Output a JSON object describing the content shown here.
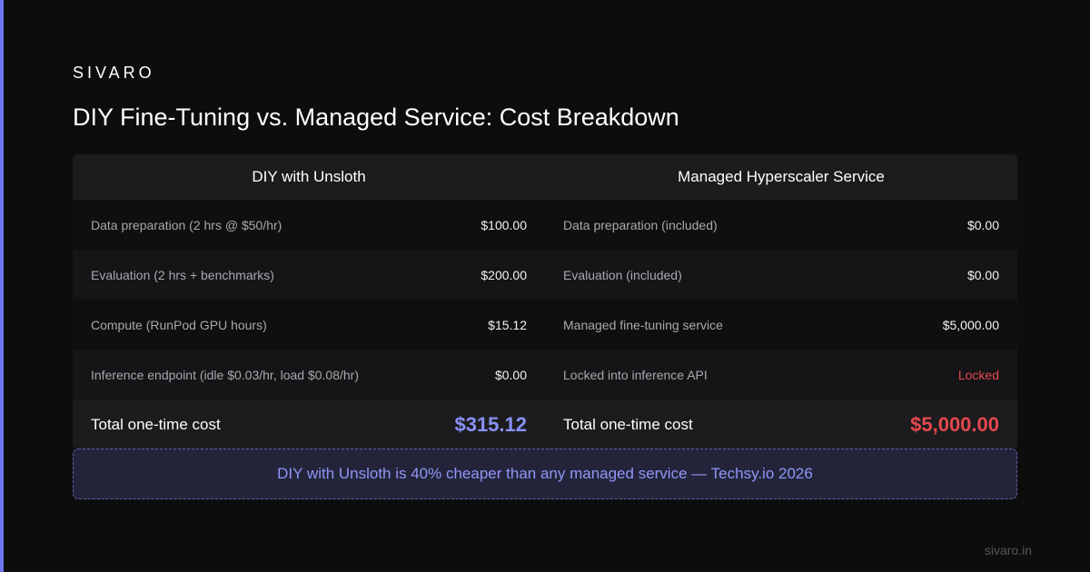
{
  "brand": "SIVARO",
  "title": "DIY Fine-Tuning vs. Managed Service: Cost Breakdown",
  "columns": {
    "diy": "DIY with Unsloth",
    "managed": "Managed Hyperscaler Service"
  },
  "rows": [
    {
      "diy_label": "Data preparation (2 hrs @ $50/hr)",
      "diy_value": "$100.00",
      "managed_label": "Data preparation (included)",
      "managed_value": "$0.00"
    },
    {
      "diy_label": "Evaluation (2 hrs + benchmarks)",
      "diy_value": "$200.00",
      "managed_label": "Evaluation (included)",
      "managed_value": "$0.00"
    },
    {
      "diy_label": "Compute (RunPod GPU hours)",
      "diy_value": "$15.12",
      "managed_label": "Managed fine-tuning service",
      "managed_value": "$5,000.00"
    },
    {
      "diy_label": "Inference endpoint (idle $0.03/hr, load $0.08/hr)",
      "diy_value": "$0.00",
      "managed_label": "Locked into inference API",
      "managed_value": "Locked"
    }
  ],
  "totals": {
    "diy_label": "Total one-time cost",
    "diy_value": "$315.12",
    "managed_label": "Total one-time cost",
    "managed_value": "$5,000.00"
  },
  "callout": "DIY with Unsloth is 40% cheaper than any managed service — Techsy.io 2026",
  "footer": "sivaro.in",
  "colors": {
    "accent": "#6d76f0",
    "diy_total": "#8891f5",
    "managed_total": "#e5484d",
    "background": "#0d0d0d"
  }
}
